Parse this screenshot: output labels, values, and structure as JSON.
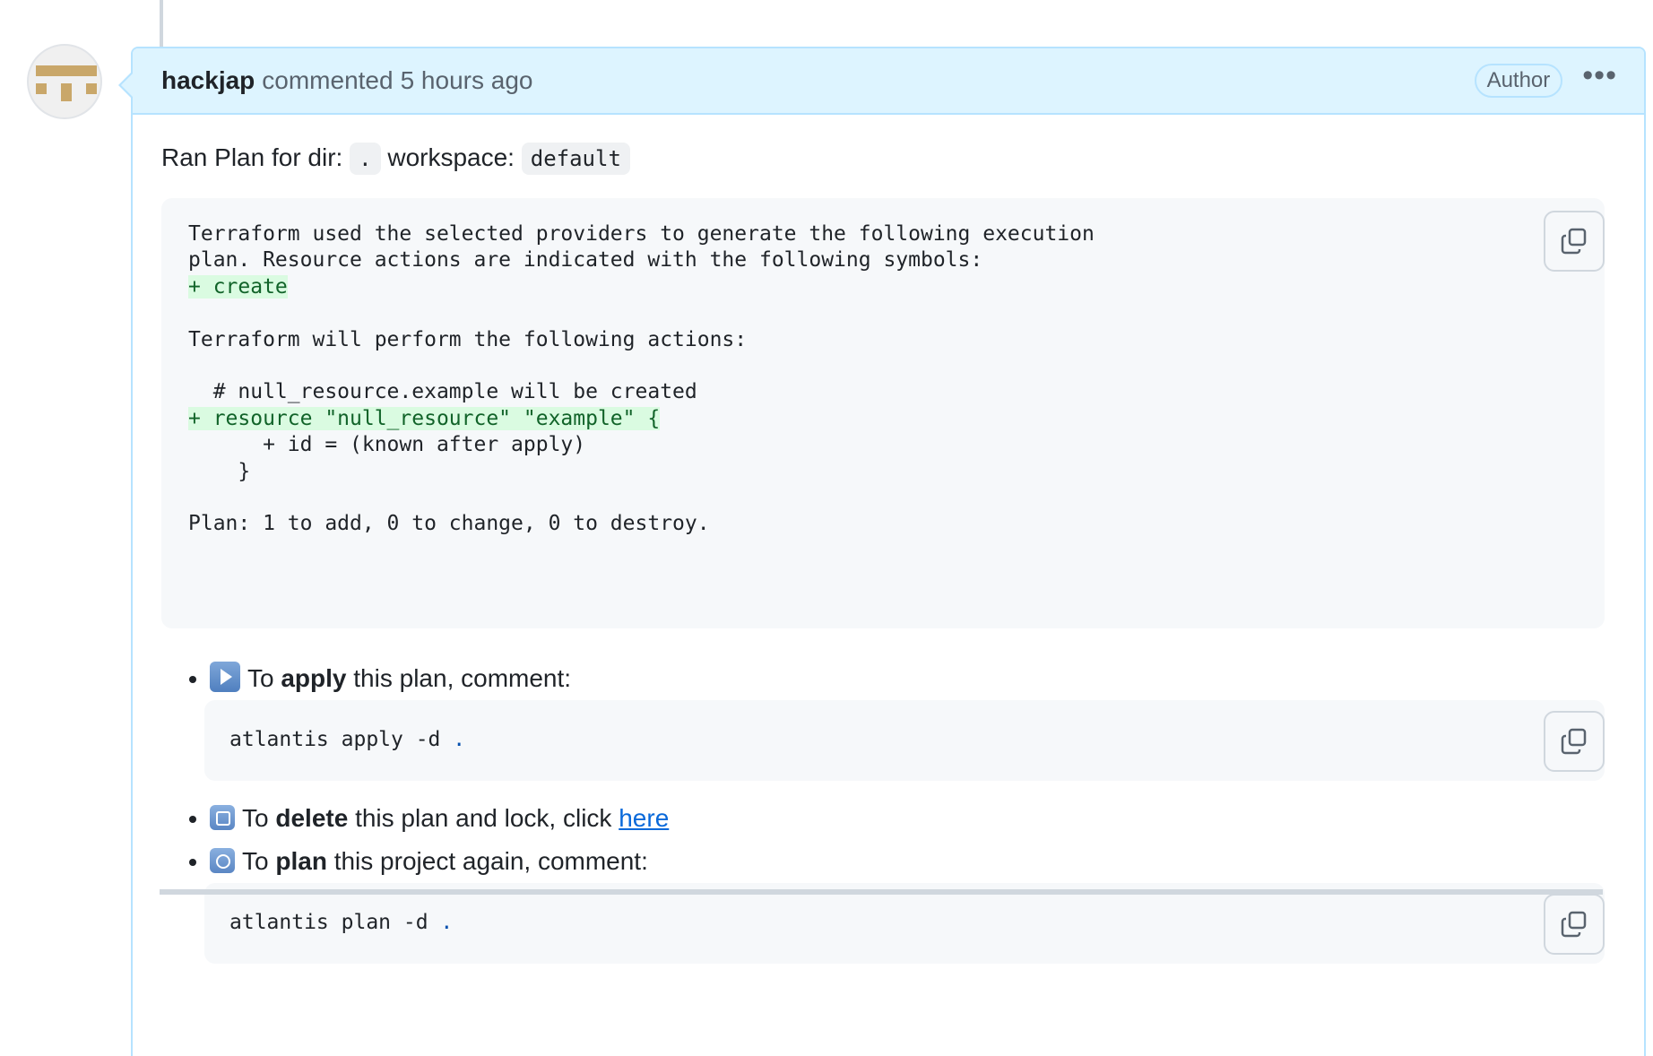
{
  "comment": {
    "author": "hackjap",
    "action_text": "commented",
    "timestamp": "5 hours ago",
    "badge": "Author",
    "menu_icon": "kebab-horizontal-icon"
  },
  "avatar": {
    "icon": "identicon-avatar",
    "color": "#c9a76a"
  },
  "body": {
    "intro_prefix": "Ran Plan for dir:",
    "dir": ".",
    "workspace_label": "workspace:",
    "workspace": "default",
    "plan_output": {
      "line1": "Terraform used the selected providers to generate the following execution",
      "line2": "plan. Resource actions are indicated with the following symbols:",
      "line3": "+ create",
      "line4": "",
      "line5": "Terraform will perform the following actions:",
      "line6": "",
      "line7": "  # null_resource.example will be created",
      "line8": "+ resource \"null_resource\" \"example\" {",
      "line9": "      + id = (known after apply)",
      "line10": "    }",
      "line11": "",
      "line12": "Plan: 1 to add, 0 to change, 0 to destroy."
    },
    "actions": {
      "apply": {
        "emoji": "play-button-emoji",
        "prefix": "To",
        "verb": "apply",
        "suffix": "this plan, comment:",
        "command": "atlantis apply -d",
        "command_arg": "."
      },
      "delete": {
        "emoji": "wastebasket-emoji",
        "prefix": "To",
        "verb": "delete",
        "suffix": "this plan and lock, click",
        "link": "here"
      },
      "plan": {
        "emoji": "repeat-emoji",
        "prefix": "To",
        "verb": "plan",
        "suffix": "this project again, comment:",
        "command": "atlantis plan -d",
        "command_arg": "."
      }
    }
  },
  "colors": {
    "header_bg": "#ddf4ff",
    "header_border": "#b6e3ff",
    "code_bg": "#f6f8fa",
    "diff_add_bg": "#dafbe1",
    "diff_add_text": "#116329",
    "link": "#0969da"
  }
}
